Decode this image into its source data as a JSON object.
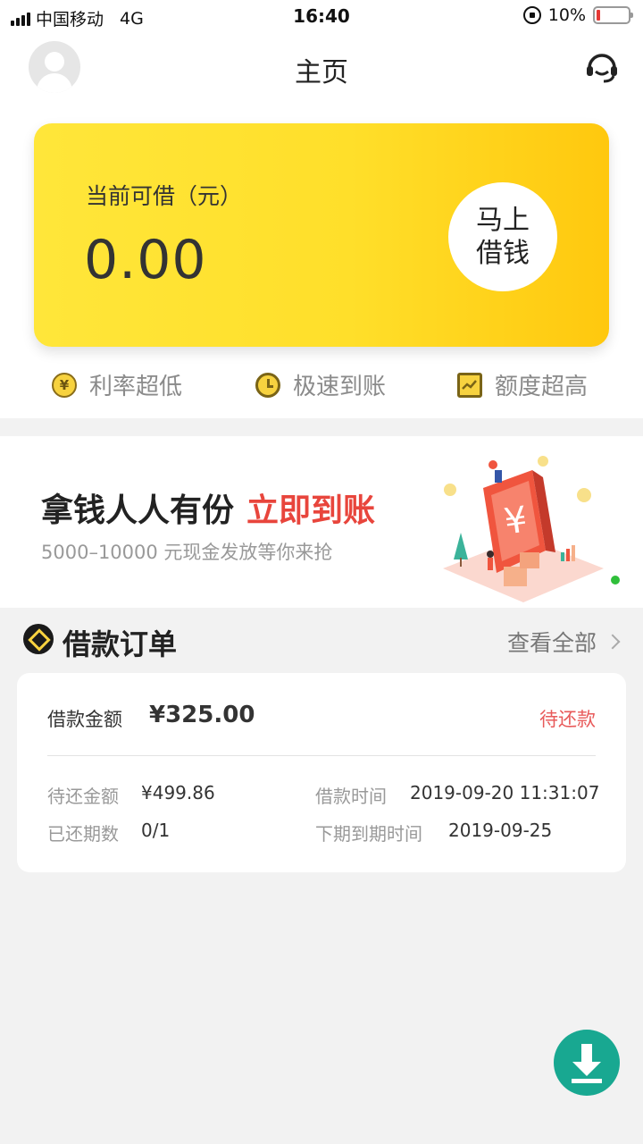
{
  "status_bar": {
    "carrier": "中国移动",
    "network": "4G",
    "time": "16:40",
    "battery": "10%"
  },
  "header": {
    "title": "主页",
    "avatar_icon": "user-avatar-icon",
    "service_icon": "headset-icon"
  },
  "loan_card": {
    "label": "当前可借（元）",
    "amount": "0.00",
    "button_line1": "马上",
    "button_line2": "借钱"
  },
  "features": [
    {
      "icon": "yen-coin-icon",
      "label": "利率超低"
    },
    {
      "icon": "alarm-clock-icon",
      "label": "极速到账"
    },
    {
      "icon": "chart-icon",
      "label": "额度超高"
    }
  ],
  "banner": {
    "title": "拿钱人人有份",
    "highlight": "立即到账",
    "subtitle": "5000–10000 元现金发放等你来抢",
    "highlight_color": "#e8453c"
  },
  "orders": {
    "title": "借款订单",
    "view_all": "查看全部",
    "card": {
      "amount_label": "借款金额",
      "amount": "¥325.00",
      "status": "待还款",
      "due_amount_label": "待还金额",
      "due_amount": "¥499.86",
      "loan_time_label": "借款时间",
      "loan_time": "2019-09-20 11:31:07",
      "paid_periods_label": "已还期数",
      "paid_periods": "0/1",
      "next_due_label": "下期到期时间",
      "next_due": "2019-09-25"
    }
  },
  "fab": {
    "icon": "download-icon",
    "color": "#18a891"
  },
  "colors": {
    "accent_yellow": "#ffd81f",
    "status_red": "#e85a5a"
  }
}
